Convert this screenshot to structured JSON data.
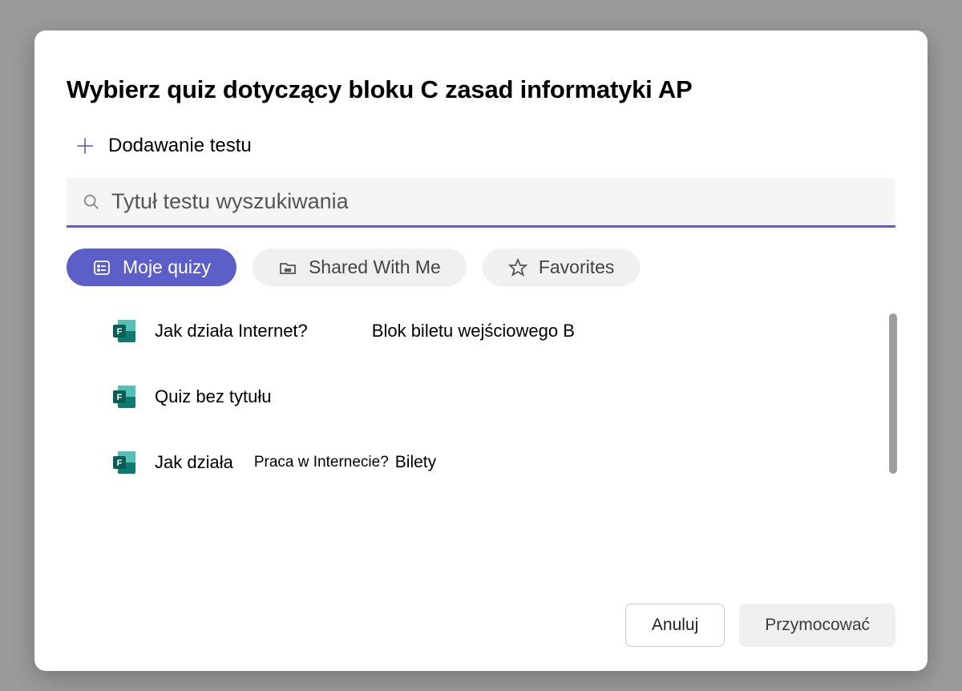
{
  "modal": {
    "title": "Wybierz quiz dotyczący bloku C zasad informatyki AP",
    "add_test_label": "Dodawanie testu",
    "search_placeholder": "Tytuł testu wyszukiwania",
    "tabs": {
      "my_quizzes": "Moje quizy",
      "shared": "Shared With Me",
      "favorites": "Favorites"
    },
    "quizzes": [
      {
        "title": "Jak działa Internet?",
        "sub": "Blok biletu wejściowego B"
      },
      {
        "title": "Quiz bez tytułu",
        "sub": ""
      },
      {
        "title": "Jak działa",
        "mid": "Praca w Internecie?",
        "right": "Bilety"
      }
    ],
    "cancel_label": "Anuluj",
    "attach_label": "Przymocować"
  }
}
